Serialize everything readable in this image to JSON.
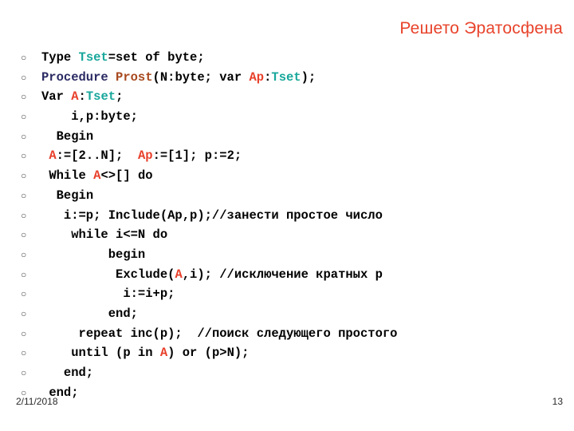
{
  "slide": {
    "title": "Решето Эратосфена",
    "title_color": "#E8432B",
    "background_color": "#FFFFFF",
    "bullet_glyph": "○"
  },
  "syntax_colors": {
    "type_name": "#18A79B",
    "variable": "#E8402B",
    "keyword": "#2B2B64",
    "procedure_name": "#A8491E",
    "plain": "#000000"
  },
  "code": {
    "lines": [
      {
        "id": 0,
        "indent": "",
        "segments": [
          {
            "text": "Type ",
            "cls": "tok-plain"
          },
          {
            "text": "Tset",
            "cls": "tok-type"
          },
          {
            "text": "=set of byte;",
            "cls": "tok-plain"
          }
        ]
      },
      {
        "id": 1,
        "indent": "",
        "segments": [
          {
            "text": "Procedure",
            "cls": "tok-kw"
          },
          {
            "text": " ",
            "cls": "tok-plain"
          },
          {
            "text": "Prost",
            "cls": "tok-proc"
          },
          {
            "text": "(N:byte; var ",
            "cls": "tok-plain"
          },
          {
            "text": "Ap",
            "cls": "tok-var"
          },
          {
            "text": ":",
            "cls": "tok-plain"
          },
          {
            "text": "Tset",
            "cls": "tok-type"
          },
          {
            "text": ");",
            "cls": "tok-plain"
          }
        ]
      },
      {
        "id": 2,
        "indent": "",
        "segments": [
          {
            "text": "Var ",
            "cls": "tok-plain"
          },
          {
            "text": "A",
            "cls": "tok-var"
          },
          {
            "text": ":",
            "cls": "tok-plain"
          },
          {
            "text": "Tset",
            "cls": "tok-type"
          },
          {
            "text": ";",
            "cls": "tok-plain"
          }
        ]
      },
      {
        "id": 3,
        "indent": "    ",
        "segments": [
          {
            "text": "i,p:byte;",
            "cls": "tok-plain"
          }
        ]
      },
      {
        "id": 4,
        "indent": "  ",
        "segments": [
          {
            "text": "Begin",
            "cls": "tok-plain"
          }
        ]
      },
      {
        "id": 5,
        "indent": " ",
        "segments": [
          {
            "text": "A",
            "cls": "tok-var"
          },
          {
            "text": ":=[2..N];  ",
            "cls": "tok-plain"
          },
          {
            "text": "Ap",
            "cls": "tok-var"
          },
          {
            "text": ":=[1]; p:=2;",
            "cls": "tok-plain"
          }
        ]
      },
      {
        "id": 6,
        "indent": " ",
        "segments": [
          {
            "text": "While ",
            "cls": "tok-plain"
          },
          {
            "text": "A",
            "cls": "tok-var"
          },
          {
            "text": "<>[] do",
            "cls": "tok-plain"
          }
        ]
      },
      {
        "id": 7,
        "indent": "  ",
        "segments": [
          {
            "text": "Begin",
            "cls": "tok-plain"
          }
        ]
      },
      {
        "id": 8,
        "indent": "   ",
        "segments": [
          {
            "text": "i:=p; Include(Ap,p);//занести простое число",
            "cls": "tok-plain"
          }
        ]
      },
      {
        "id": 9,
        "indent": "    ",
        "segments": [
          {
            "text": "while i<=N do",
            "cls": "tok-plain"
          }
        ]
      },
      {
        "id": 10,
        "indent": "         ",
        "segments": [
          {
            "text": "begin",
            "cls": "tok-plain"
          }
        ]
      },
      {
        "id": 11,
        "indent": "          ",
        "segments": [
          {
            "text": "Exclude(",
            "cls": "tok-plain"
          },
          {
            "text": "A",
            "cls": "tok-var"
          },
          {
            "text": ",i); //исключение кратных p",
            "cls": "tok-plain"
          }
        ]
      },
      {
        "id": 12,
        "indent": "           ",
        "segments": [
          {
            "text": "i:=i+p;",
            "cls": "tok-plain"
          }
        ]
      },
      {
        "id": 13,
        "indent": "         ",
        "segments": [
          {
            "text": "end;",
            "cls": "tok-plain"
          }
        ]
      },
      {
        "id": 14,
        "indent": "     ",
        "segments": [
          {
            "text": "repeat inc(p);  //поиск следующего простого",
            "cls": "tok-plain"
          }
        ]
      },
      {
        "id": 15,
        "indent": "    ",
        "segments": [
          {
            "text": "until (p in ",
            "cls": "tok-plain"
          },
          {
            "text": "A",
            "cls": "tok-var"
          },
          {
            "text": ") or (p>N);",
            "cls": "tok-plain"
          }
        ]
      },
      {
        "id": 16,
        "indent": "   ",
        "segments": [
          {
            "text": "end;",
            "cls": "tok-plain"
          }
        ]
      },
      {
        "id": 17,
        "indent": " ",
        "segments": [
          {
            "text": "end;",
            "cls": "tok-plain"
          }
        ]
      }
    ]
  },
  "footer": {
    "date": "2/11/2018",
    "page_number": "13"
  }
}
